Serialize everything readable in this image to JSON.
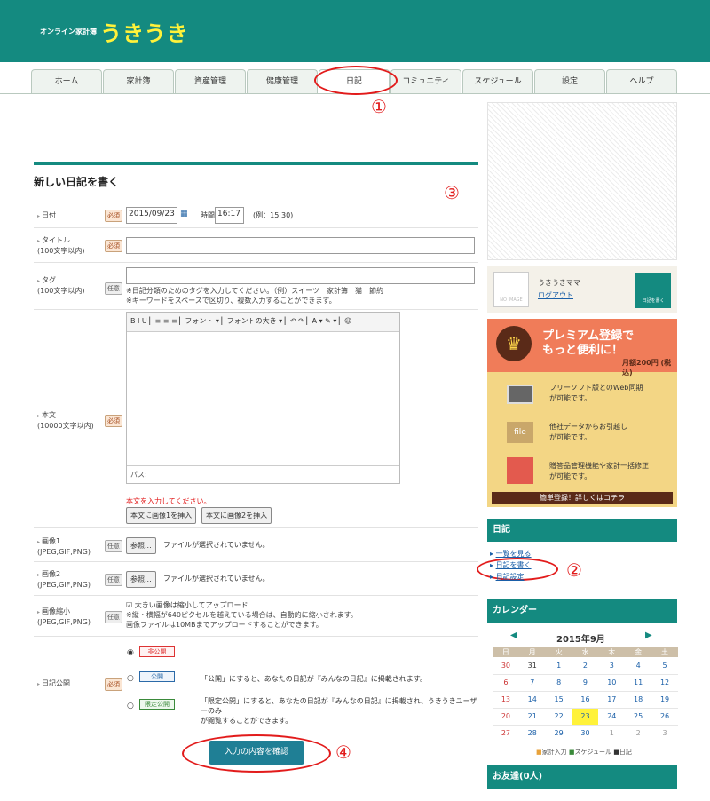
{
  "header": {
    "small": "オンライン家計簿",
    "brand": "うきうき"
  },
  "tabs": [
    "ホーム",
    "家計簿",
    "資産管理",
    "健康管理",
    "日記",
    "コミュニティ",
    "スケジュール",
    "設定",
    "ヘルプ"
  ],
  "markers": [
    "①",
    "②",
    "③",
    "④"
  ],
  "form": {
    "title": "新しい日記を書く",
    "required_badge": "必須",
    "optional_badge": "任意",
    "date_label": "日付",
    "date_value": "2015/09/23",
    "time_label": "時間",
    "time_value": "16:17",
    "time_example": "(例：15:30)",
    "title_label_1": "タイトル",
    "title_label_2": "(100文字以内)",
    "tag_label_1": "タグ",
    "tag_label_2": "(100文字以内)",
    "tag_note_1": "※日記分類のためのタグを入力してください。（例）スイーツ　家計簿　猫　節約",
    "tag_note_2": "※キーワードをスペースで区切り、複数入力することができます。",
    "body_label_1": "本文",
    "body_label_2": "(10000文字以内)",
    "editor_toolbar": "B  I  U  ▏≡  ≡  ≡ ▏フォント ▾ ▏フォントの大き ▾ ▏↶ ↷ ▏A ▾  ✎ ▾ ▏☺",
    "editor_path": "パス:",
    "body_error": "本文を入力してください。",
    "insert_img1": "本文に画像1を挿入",
    "insert_img2": "本文に画像2を挿入",
    "img1_label_1": "画像1",
    "img1_label_2": "(JPEG,GIF,PNG)",
    "img2_label_1": "画像2",
    "img2_label_2": "(JPEG,GIF,PNG)",
    "browse": "参照...",
    "no_file": "ファイルが選択されていません。",
    "shrink_label_1": "画像縮小",
    "shrink_label_2": "(JPEG,GIF,PNG)",
    "shrink_check": "大きい画像は縮小してアップロード",
    "shrink_note_1": "※縦・横幅が640ピクセルを越えている場合は、自動的に縮小されます。",
    "shrink_note_2": "画像ファイルは10MBまでアップロードすることができます。",
    "publish_label": "日記公開",
    "opt_private": "非公開",
    "opt_public": "公開",
    "opt_public_note": "「公開」にすると、あなたの日記が『みんなの日記』に掲載されます。",
    "opt_limited": "限定公開",
    "opt_limited_note_1": "「限定公開」にすると、あなたの日記が『みんなの日記』に掲載され、うきうきユーザーのみ",
    "opt_limited_note_2": "が閲覧することができます。",
    "confirm": "入力の内容を確認"
  },
  "user": {
    "no_image": "NO IMAGE",
    "name": "うきうきママ",
    "logout": "ログアウト",
    "write": "日記を書く"
  },
  "premium": {
    "title_1": "プレミアム登録で",
    "title_2": "もっと便利に！",
    "price": "月額200円",
    "price_sub": "(税込)",
    "f1_1": "フリーソフト版とのWeb同期",
    "f1_2": "が可能です。",
    "f2_1": "他社データからお引越し",
    "f2_2": "が可能です。",
    "f3_1": "贈答品管理機能や家計一括修正",
    "f3_2": "が可能です。",
    "file_label": "file",
    "cta": "簡単登録！詳しくはコチラ"
  },
  "diary_menu": {
    "head": "日記",
    "items": [
      "一覧を見る",
      "日記を書く",
      "日記設定"
    ]
  },
  "calendar": {
    "head": "カレンダー",
    "month": "2015年9月",
    "weekdays": [
      "日",
      "月",
      "火",
      "水",
      "木",
      "金",
      "土"
    ],
    "weeks": [
      [
        "30",
        "31",
        "1",
        "2",
        "3",
        "4",
        "5"
      ],
      [
        "6",
        "7",
        "8",
        "9",
        "10",
        "11",
        "12"
      ],
      [
        "13",
        "14",
        "15",
        "16",
        "17",
        "18",
        "19"
      ],
      [
        "20",
        "21",
        "22",
        "23",
        "24",
        "25",
        "26"
      ],
      [
        "27",
        "28",
        "29",
        "30",
        "1",
        "2",
        "3"
      ]
    ],
    "legend": [
      "家計入力",
      "スケジュール",
      "日記"
    ]
  },
  "friends": {
    "head": "お友達(0人)"
  }
}
